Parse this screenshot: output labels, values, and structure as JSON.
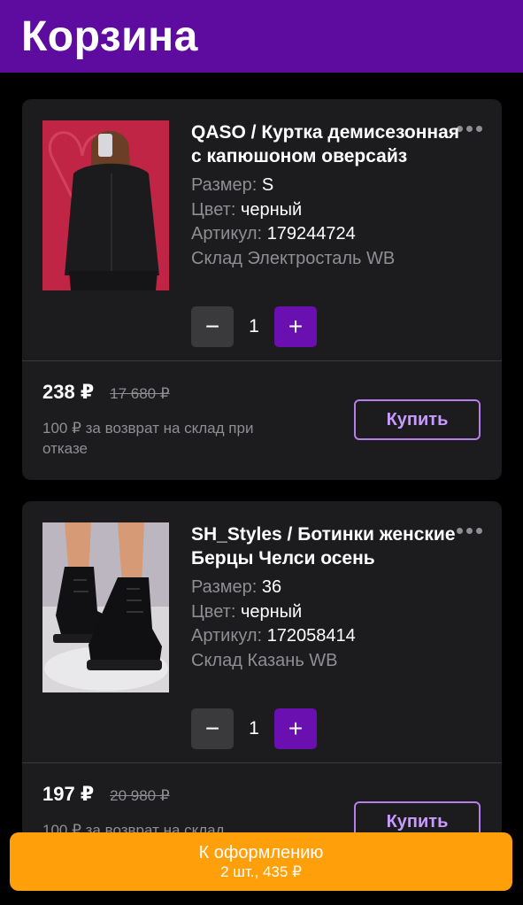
{
  "header": {
    "title": "Корзина"
  },
  "labels": {
    "size": "Размер:",
    "color": "Цвет:",
    "article": "Артикул:",
    "buy": "Купить",
    "minus": "−",
    "plus": "+"
  },
  "items": [
    {
      "title": "QASO / Куртка демисезонная с капюшоном оверсайз",
      "size": "S",
      "color": "черный",
      "article": "179244724",
      "warehouse": "Склад Электросталь WB",
      "quantity": "1",
      "price": "238 ₽",
      "old_price": "17 680 ₽",
      "return_note": "100 ₽ за возврат на склад при отказе"
    },
    {
      "title": "SH_Styles / Ботинки женские Берцы Челси осень",
      "size": "36",
      "color": "черный",
      "article": "172058414",
      "warehouse": "Склад Казань WB",
      "quantity": "1",
      "price": "197 ₽",
      "old_price": "20 980 ₽",
      "return_note": "100 ₽ за возврат на склад"
    }
  ],
  "checkout": {
    "label": "К оформлению",
    "summary": "2 шт., 435 ₽"
  },
  "colors": {
    "header_bg": "#5e0ca0",
    "card_bg": "#1c1c1e",
    "plus_bg": "#6a0fb0",
    "checkout_bg": "#ff9f0a",
    "buy_border": "#b47fe8"
  }
}
